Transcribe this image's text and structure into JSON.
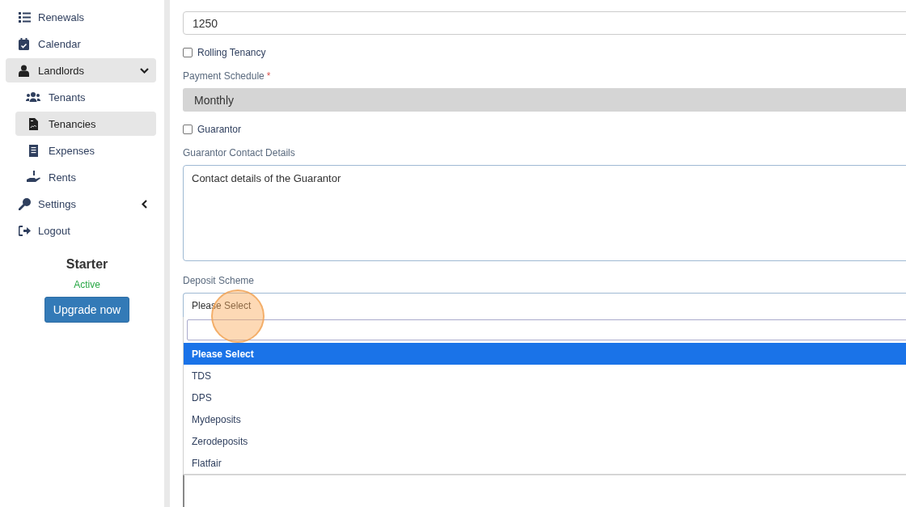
{
  "sidebar": {
    "items": [
      {
        "label": "Renewals",
        "selected": false
      },
      {
        "label": "Calendar",
        "selected": false
      },
      {
        "label": "Landlords",
        "selected": true,
        "expanded": true,
        "children": [
          {
            "label": "Tenants",
            "selected": false
          },
          {
            "label": "Tenancies",
            "selected": true
          },
          {
            "label": "Expenses",
            "selected": false
          },
          {
            "label": "Rents",
            "selected": false
          }
        ]
      },
      {
        "label": "Settings",
        "selected": false,
        "expanded": false
      },
      {
        "label": "Logout",
        "selected": false
      }
    ],
    "plan": {
      "name": "Starter",
      "status": "Active",
      "button": "Upgrade now"
    }
  },
  "form": {
    "rent": {
      "value": "1250"
    },
    "rolling_tenancy": {
      "label": "Rolling Tenancy",
      "checked": false
    },
    "payment_schedule": {
      "label": "Payment Schedule",
      "required_mark": "*",
      "value": "Monthly"
    },
    "guarantor": {
      "label": "Guarantor",
      "checked": false
    },
    "guarantor_contact": {
      "label": "Guarantor Contact Details",
      "placeholder": "Contact details of the Guarantor"
    },
    "deposit_scheme": {
      "label": "Deposit Scheme",
      "value": "Please Select",
      "options": [
        {
          "label": "Please Select",
          "selected": true
        },
        {
          "label": "TDS",
          "selected": false
        },
        {
          "label": "DPS",
          "selected": false
        },
        {
          "label": "Mydeposits",
          "selected": false
        },
        {
          "label": "Zerodeposits",
          "selected": false
        },
        {
          "label": "Flatfair",
          "selected": false
        }
      ]
    }
  }
}
